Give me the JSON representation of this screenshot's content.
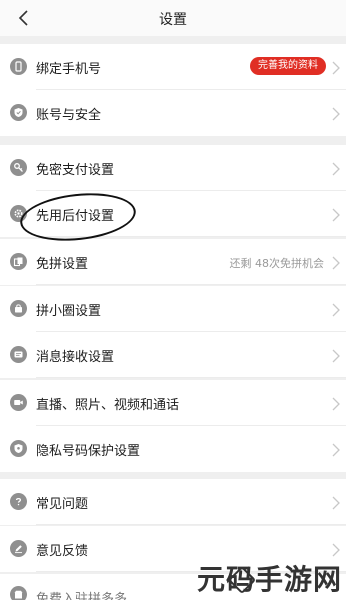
{
  "header": {
    "title": "设置"
  },
  "groups": {
    "account": [
      {
        "label": "绑定手机号",
        "badge": "完善我的资料",
        "icon": "phone-icon"
      },
      {
        "label": "账号与安全",
        "icon": "shield-icon"
      }
    ],
    "payment": [
      {
        "label": "免密支付设置",
        "icon": "key-icon"
      },
      {
        "label": "先用后付设置",
        "icon": "gear-icon"
      },
      {
        "label": "免拼设置",
        "note": "还剩 48次免拼机会",
        "icon": "cards-icon"
      },
      {
        "label": "拼小圈设置",
        "icon": "bag-icon"
      },
      {
        "label": "消息接收设置",
        "icon": "message-icon"
      },
      {
        "label": "直播、照片、视频和通话",
        "icon": "camera-icon"
      },
      {
        "label": "隐私号码保护设置",
        "icon": "privacy-shield-icon"
      }
    ],
    "help": [
      {
        "label": "常见问题",
        "icon": "question-icon"
      },
      {
        "label": "意见反馈",
        "icon": "pen-icon"
      },
      {
        "label": "免费入驻拼多多",
        "icon": "store-icon"
      }
    ]
  },
  "watermark": "元码手游网",
  "colors": {
    "accent": "#e02e24",
    "icon_gray": "#8f8f8f",
    "background": "#efefef"
  }
}
